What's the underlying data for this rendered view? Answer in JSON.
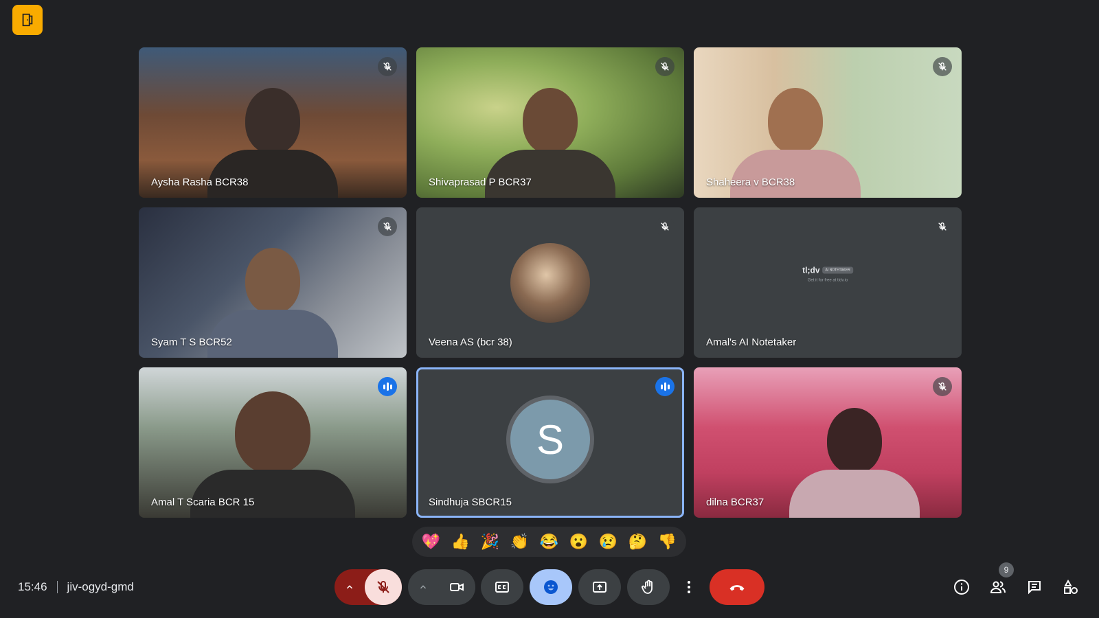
{
  "meeting": {
    "time": "15:46",
    "code": "jiv-ogyd-gmd"
  },
  "app_badge_icon": "door-icon",
  "participants": [
    {
      "name": "Aysha Rasha BCR38",
      "state": "muted"
    },
    {
      "name": "Shivaprasad P BCR37",
      "state": "muted"
    },
    {
      "name": "Shaheera v BCR38",
      "state": "muted"
    },
    {
      "name": "Syam T S BCR52",
      "state": "muted"
    },
    {
      "name": "Veena AS (bcr 38)",
      "state": "muted"
    },
    {
      "name": "Amal's AI Notetaker",
      "state": "muted"
    },
    {
      "name": "Amal T Scaria BCR 15",
      "state": "speaking"
    },
    {
      "name": "Sindhuja SBCR15",
      "state": "speaking",
      "avatar_letter": "S"
    },
    {
      "name": "dilna BCR37",
      "state": "muted"
    }
  ],
  "notetaker_card": {
    "brand": "tl;dv",
    "tag": "AI NOTETAKER",
    "subtitle": "Get it for free at tldv.io"
  },
  "reactions": [
    "💖",
    "👍",
    "🎉",
    "👏",
    "😂",
    "😮",
    "😢",
    "🤔",
    "👎"
  ],
  "people_count": "9",
  "colors": {
    "accent": "#8ab4f8",
    "leave": "#d93025",
    "mic_off_bg": "#f9dedc",
    "emoji_active": "#a8c7fa",
    "badge": "#f9ab00"
  }
}
